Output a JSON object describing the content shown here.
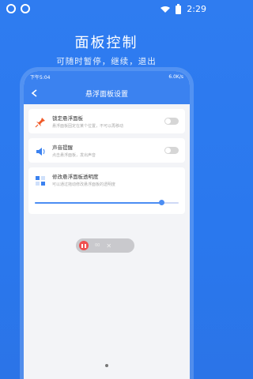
{
  "status": {
    "time": "2:29"
  },
  "hero": {
    "title": "面板控制",
    "subtitle": "可随时暂停，继续，退出"
  },
  "phone": {
    "status_time": "下午5:04",
    "status_right": "6.0K/s",
    "header_title": "悬浮面板设置",
    "cards": [
      {
        "title": "锁定悬浮面板",
        "desc": "悬浮面板固定在某个位置，不可以再移动"
      },
      {
        "title": "声音提醒",
        "desc": "点击悬浮面板，发出声音"
      },
      {
        "title": "修改悬浮面板透明度",
        "desc": "可以通过拖动修改悬浮面板的透明度"
      }
    ],
    "slider_value": 0.88,
    "float_panel": {
      "label": "00",
      "close": "✕"
    }
  }
}
